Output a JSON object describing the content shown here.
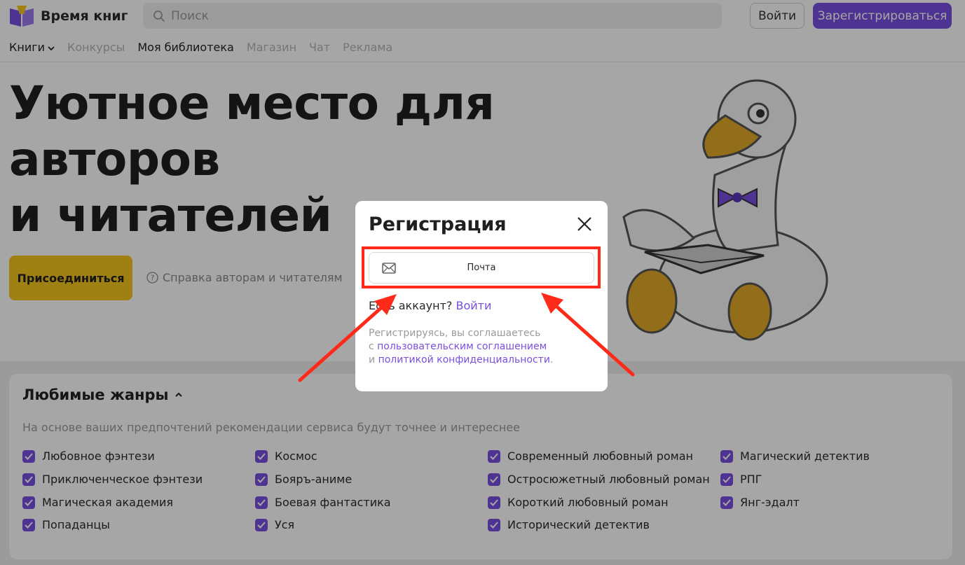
{
  "header": {
    "logo_text": "Время книг",
    "search_placeholder": "Поиск",
    "login_label": "Войти",
    "register_label": "Зарегистрироваться"
  },
  "nav": {
    "items": [
      {
        "label": "Книги"
      },
      {
        "label": "Конкурсы"
      },
      {
        "label": "Моя библиотека"
      },
      {
        "label": "Магазин"
      },
      {
        "label": "Чат"
      },
      {
        "label": "Реклама"
      }
    ]
  },
  "hero": {
    "title_line1": "Уютное место для",
    "title_line2": "авторов",
    "title_line3": "и читателей",
    "join_label": "Присоединиться",
    "help_label": "Справка авторам и читателям"
  },
  "genres": {
    "title": "Любимые жанры",
    "subtitle": "На основе ваших предпочтений рекомендации сервиса будут точнее и интереснее",
    "items": [
      "Любовное фэнтези",
      "Приключенческое фэнтези",
      "Магическая академия",
      "Попаданцы",
      "Космос",
      "Бояръ-аниме",
      "Боевая фантастика",
      "Уся",
      "Современный любовный роман",
      "Остросюжетный любовный роман",
      "Короткий любовный роман",
      "Исторический детектив",
      "Магический детектив",
      "РПГ",
      "Янг-эдалт"
    ]
  },
  "modal": {
    "title": "Регистрация",
    "mail_label": "Почта",
    "have_account": "Есть аккаунт?",
    "login_link": "Войти",
    "legal_line1": "Регистрируясь, вы соглашаетесь",
    "legal_c": "с",
    "legal_link1": "пользовательским соглашением",
    "legal_i": "и",
    "legal_link2": "политикой конфиденциальности",
    "legal_dot": "."
  },
  "colors": {
    "accent": "#7a4fe0",
    "join_button": "#f4c51e",
    "highlight": "#ff2a1a"
  }
}
